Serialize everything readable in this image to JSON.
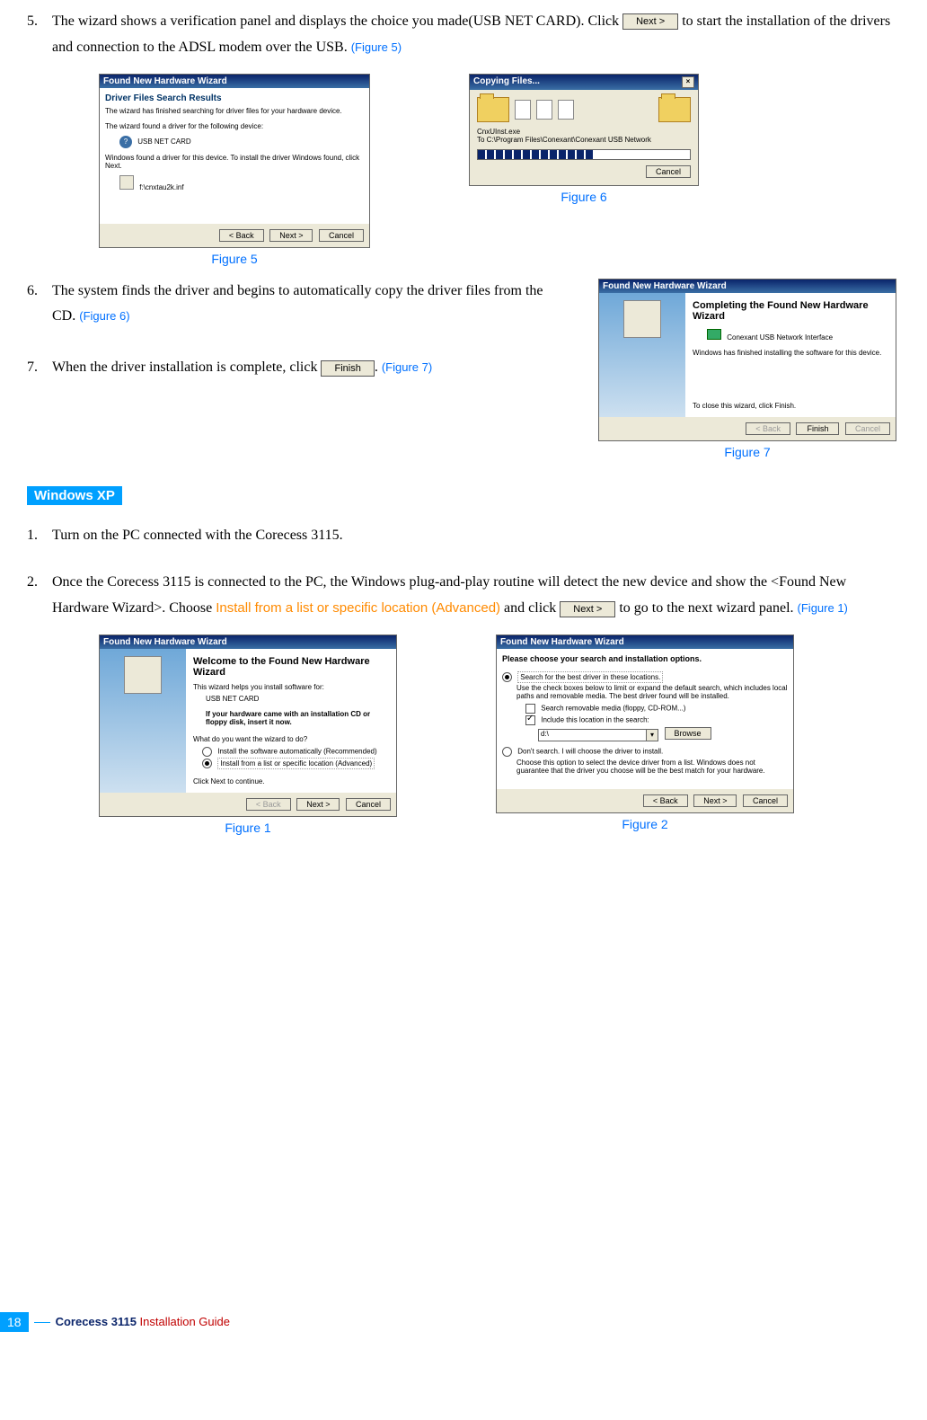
{
  "step5": {
    "num": "5.",
    "text_a": "The wizard shows a verification panel and displays the choice you made(USB NET CARD). Click ",
    "btn": "Next >",
    "text_b": " to start the installation of the drivers and connection to the ADSL modem over the USB. ",
    "figref": "(Figure 5)"
  },
  "fig5": {
    "title": "Found New Hardware Wizard",
    "subhead": "Driver Files Search Results",
    "sub2": "The wizard has finished searching for driver files for your hardware device.",
    "line1": "The wizard found a driver for the following device:",
    "device": "USB NET CARD",
    "line2": "Windows found a driver for this device. To install the driver Windows found, click Next.",
    "filepath": "f:\\cnxtau2k.inf",
    "back": "< Back",
    "next": "Next >",
    "cancel": "Cancel",
    "caption": "Figure 5"
  },
  "fig6": {
    "title": "Copying Files...",
    "file": "CnxUInst.exe",
    "dest": "To C:\\Program Files\\Conexant\\Conexant USB Network",
    "cancel": "Cancel",
    "caption": "Figure 6"
  },
  "step6": {
    "num": "6.",
    "text": "The system finds the driver and begins to automatically copy the driver files from the CD. ",
    "figref": "(Figure 6)"
  },
  "step7": {
    "num": "7.",
    "text_a": "When the driver installation is complete, click ",
    "btn": "Finish",
    "text_b": ". ",
    "figref": "(Figure 7)"
  },
  "fig7": {
    "title": "Found New Hardware Wizard",
    "head": "Completing the Found New Hardware Wizard",
    "device": "Conexant USB Network Interface",
    "line": "Windows has finished installing the software for this device.",
    "close": "To close this wizard, click Finish.",
    "back": "< Back",
    "finish": "Finish",
    "cancel": "Cancel",
    "caption": "Figure 7"
  },
  "section": "Windows XP",
  "xp1": {
    "num": "1.",
    "text": "Turn on the PC connected with the Corecess 3115."
  },
  "xp2": {
    "num": "2.",
    "text_a": "Once the Corecess 3115 is connected to the PC, the Windows plug-and-play routine will detect the new device and show the <Found New Hardware Wizard>. Choose ",
    "highlight": "Install from a list or specific location (Advanced)",
    "text_b": " and click ",
    "btn": "Next >",
    "text_c": " to go to the next wizard panel. ",
    "figref": "(Figure 1)"
  },
  "figxp1": {
    "title": "Found New Hardware Wizard",
    "head": "Welcome to the Found New Hardware Wizard",
    "l1": "This wizard helps you install software for:",
    "device": "USB NET CARD",
    "l2": "If your hardware came with an installation CD or floppy disk, insert it now.",
    "l3": "What do you want the wizard to do?",
    "opt1": "Install the software automatically (Recommended)",
    "opt2": "Install from a list or specific location (Advanced)",
    "l4": "Click Next to continue.",
    "back": "< Back",
    "next": "Next >",
    "cancel": "Cancel",
    "caption": "Figure 1"
  },
  "figxp2": {
    "title": "Found New Hardware Wizard",
    "head": "Please choose your search and installation options.",
    "opt1": "Search for the best driver in these locations.",
    "opt1_desc": "Use the check boxes below to limit or expand the default search, which includes local paths and removable media. The best driver found will be installed.",
    "chk1": "Search removable media (floppy, CD-ROM...)",
    "chk2": "Include this location in the search:",
    "path": "d:\\",
    "browse": "Browse",
    "opt2": "Don't search. I will choose the driver to install.",
    "opt2_desc": "Choose this option to select the device driver from a list. Windows does not guarantee that the driver you choose will be the best match for your hardware.",
    "back": "< Back",
    "next": "Next >",
    "cancel": "Cancel",
    "caption": "Figure 2"
  },
  "footer": {
    "page": "18",
    "title_bold": "Corecess 3115",
    "title_rest": " Installation Guide"
  }
}
